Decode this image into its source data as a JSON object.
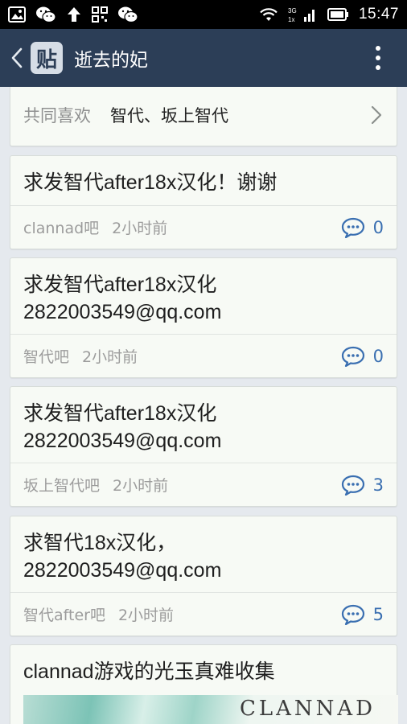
{
  "status_bar": {
    "time": "15:47",
    "network": "3G",
    "left_icons": [
      "image-icon",
      "wechat-icon",
      "upload-arrow-icon",
      "qr-code-icon",
      "wechat-icon"
    ],
    "right_icons": [
      "wifi-icon",
      "signal-icon",
      "battery-icon"
    ]
  },
  "header": {
    "logo_text": "贴",
    "title": "逝去的妃"
  },
  "common_likes": {
    "label": "共同喜欢",
    "value": "智代、坂上智代"
  },
  "posts": [
    {
      "title": "求发智代after18x汉化！谢谢",
      "forum": "clannad吧",
      "time": "2小时前",
      "comments": "0"
    },
    {
      "title": "求发智代after18x汉化\n2822003549@qq.com",
      "forum": "智代吧",
      "time": "2小时前",
      "comments": "0"
    },
    {
      "title": "求发智代after18x汉化\n2822003549@qq.com",
      "forum": "坂上智代吧",
      "time": "2小时前",
      "comments": "3"
    },
    {
      "title": "求智代18x汉化，\n2822003549@qq.com",
      "forum": "智代after吧",
      "time": "2小时前",
      "comments": "5"
    },
    {
      "title": "clannad游戏的光玉真难收集",
      "image_text": "CLANNAD"
    }
  ],
  "colors": {
    "header_bg": "#2c3e57",
    "accent_blue": "#3a6fb1",
    "page_bg": "#e5e9ee",
    "card_bg": "#f7faf5"
  }
}
